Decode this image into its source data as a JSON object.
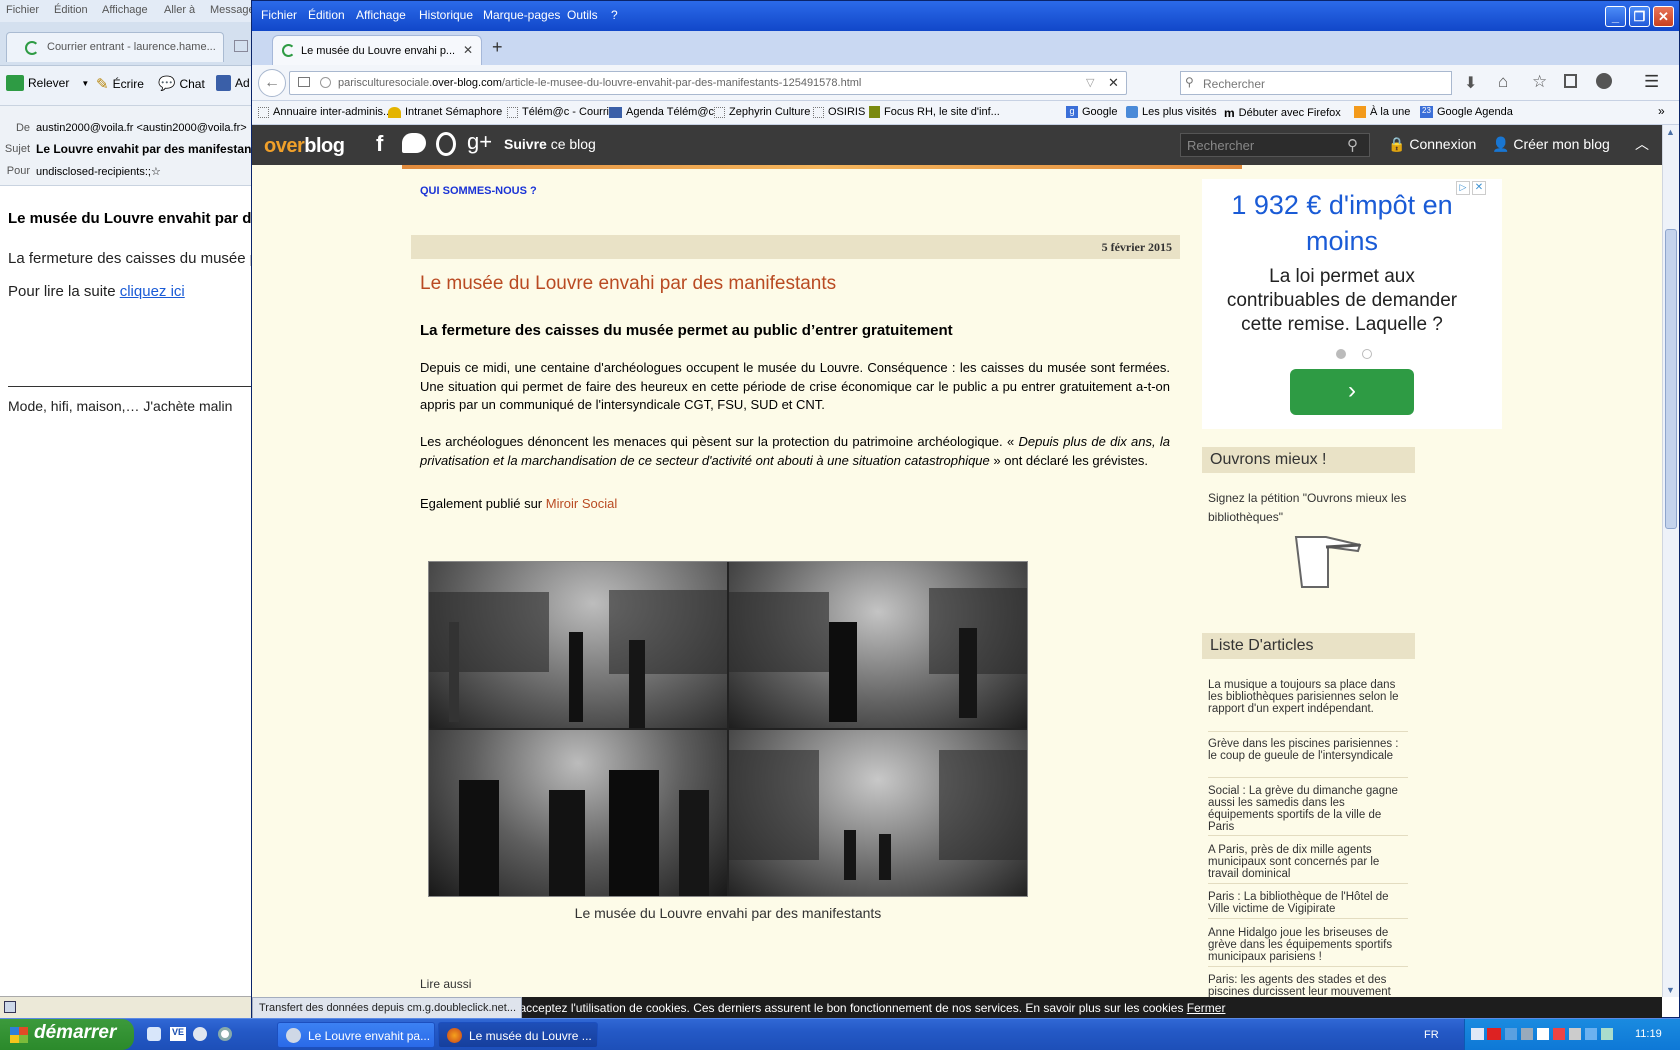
{
  "thunderbird": {
    "menu": [
      "Fichier",
      "Édition",
      "Affichage",
      "Aller à",
      "Message"
    ],
    "tab_label": "Courrier entrant - laurence.hame...",
    "toolbar": {
      "relever": "Relever",
      "ecrire": "Écrire",
      "chat": "Chat",
      "ad": "Ad"
    },
    "headers": {
      "de_label": "De",
      "de_value": "austin2000@voila.fr <austin2000@voila.fr>",
      "sujet_label": "Sujet",
      "sujet_value": "Le Louvre envahit par des manifestants",
      "pour_label": "Pour",
      "pour_value": "undisclosed-recipients:;"
    },
    "body": {
      "title": "Le musée du Louvre envahit par des manifestants",
      "line1": "La fermeture des caisses du musée permet au public d'entrer gratuitement",
      "read_more_prefix": "Pour lire la suite ",
      "read_more_link": "cliquez ici",
      "ad_line": "Mode, hifi, maison,… J'achète malin"
    }
  },
  "firefox": {
    "menu": [
      "Fichier",
      "Édition",
      "Affichage",
      "Historique",
      "Marque-pages",
      "Outils",
      "?"
    ],
    "tab_title": "Le musée du Louvre envahi p...",
    "url_prefix": "parisculturesociale.",
    "url_domain": "over-blog.com",
    "url_path": "/article-le-musee-du-louvre-envahit-par-des-manifestants-125491578.html",
    "search_placeholder": "Rechercher",
    "bookmarks": [
      "Annuaire inter-adminis...",
      "Intranet Sémaphore",
      "Télém@c - Courrier",
      "Agenda Télém@c",
      "Zephyrin Culture",
      "OSIRIS",
      "Focus RH, le site d'inf...",
      "Google",
      "Les plus visités",
      "Débuter avec Firefox",
      "À la une",
      "Google Agenda"
    ],
    "status": "Transfert des données depuis cm.g.doubleclick.net...",
    "cookie_text": "En poursuivant votre navigation sur ce site, vous acceptez l'utilisation de cookies. Ces derniers assurent le bon fonctionnement de nos services. En savoir plus sur les cookies",
    "cookie_close": "Fermer"
  },
  "overblog": {
    "logo_over": "over",
    "logo_blog": "blog",
    "follow_bold": "Suivre",
    "follow_rest": " ce blog",
    "search_placeholder": "Rechercher",
    "login": "Connexion",
    "create": "Créer mon blog"
  },
  "article": {
    "nav_link": "QUI SOMMES-NOUS ?",
    "date": "5 février 2015",
    "title": "Le musée du Louvre envahi par des manifestants",
    "subtitle": "La fermeture des caisses du musée permet au public d’entrer gratuitement",
    "p1": "Depuis ce midi, une centaine d'archéologues occupent le musée du Louvre. Conséquence : les caisses du musée sont fermées. Une situation qui permet de faire des heureux en cette période de crise économique car le public a pu entrer gratuitement a-t-on appris par un communiqué de l'intersyndicale CGT, FSU, SUD et CNT.",
    "p2_a": "Les archéologues dénoncent les menaces qui pèsent sur la protection du patrimoine archéologique. « ",
    "p2_em": "Depuis plus de dix ans, la privatisation et la marchandisation de ce secteur d'activité ont abouti à une situation catastrophique",
    "p2_b": " » ont déclaré les grévistes.",
    "p3_prefix": "Egalement publié sur ",
    "p3_link": "Miroir Social",
    "caption": "Le musée du Louvre envahi par des manifestants",
    "lire_aussi": "Lire aussi"
  },
  "ad": {
    "headline": "1 932 € d'impôt en moins",
    "body": "La loi permet aux contribuables de demander cette remise. Laquelle ?"
  },
  "sidebar": {
    "box1_title": "Ouvrons mieux !",
    "box1_text": "Signez la pétition \"Ouvrons mieux les bibliothèques\"",
    "box2_title": "Liste D'articles",
    "articles": [
      "La musique a toujours sa place dans les bibliothèques parisiennes selon le rapport d'un expert indépendant.",
      "Grève dans les piscines parisiennes : le coup de gueule de l'intersyndicale",
      "Social : La grève du dimanche gagne aussi les samedis dans les équipements sportifs de la ville de Paris",
      "A Paris, près de dix mille agents municipaux sont concernés par le travail dominical",
      "Paris : La bibliothèque de l'Hôtel de Ville victime de Vigipirate",
      "Anne Hidalgo joue les briseuses de grève dans les équipements sportifs municipaux parisiens !",
      "Paris: les agents des stades et des piscines durcissent leur mouvement"
    ]
  },
  "taskbar": {
    "start": "démarrer",
    "tasks": [
      "Le Louvre envahit pa...",
      "Le musée du Louvre ..."
    ],
    "lang": "FR",
    "clock": "11:19"
  },
  "colors": {
    "accent_title": "#b94a22",
    "overblog_bar": "#3a3a3a",
    "ad_button": "#2e9b44",
    "page_bg": "#fdfbe8"
  }
}
